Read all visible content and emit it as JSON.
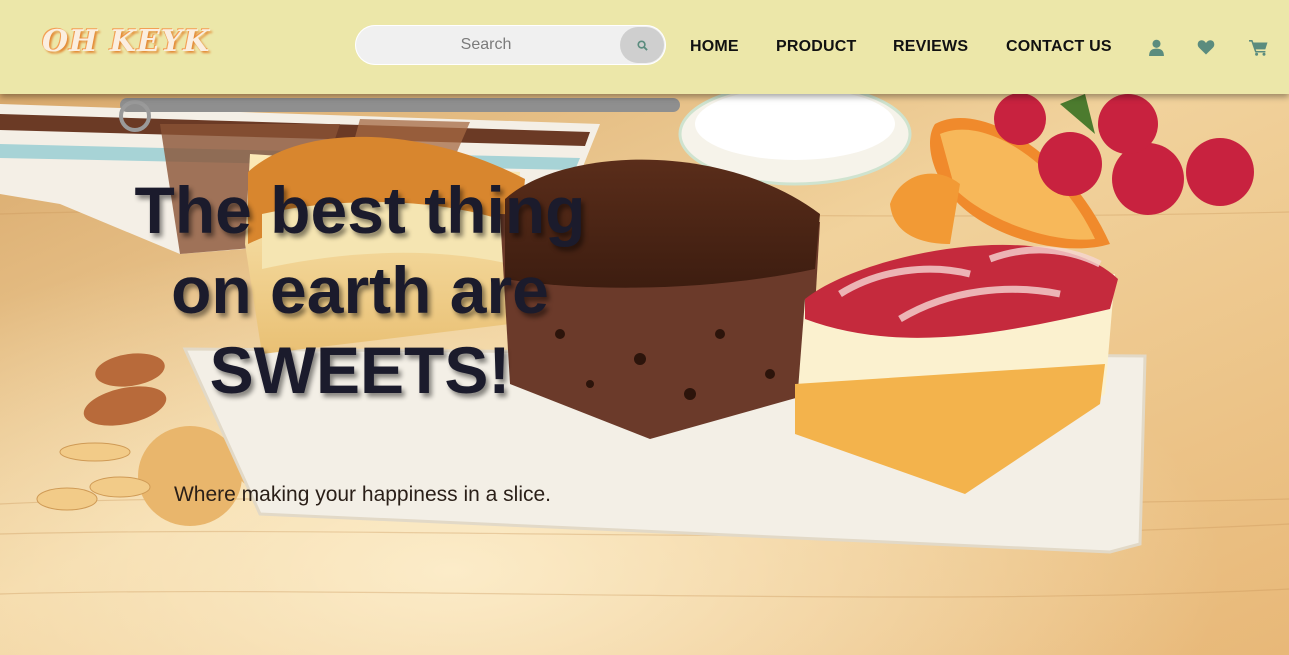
{
  "header": {
    "logo": "OH KEYK",
    "search": {
      "placeholder": "Search",
      "value": "",
      "button_icon": "search-icon"
    },
    "nav": [
      {
        "label": "HOME"
      },
      {
        "label": "PRODUCT"
      },
      {
        "label": "REVIEWS"
      },
      {
        "label": "CONTACT US"
      }
    ],
    "icons": [
      "user-icon",
      "heart-icon",
      "cart-icon"
    ],
    "colors": {
      "header_bg": "#ece7a9",
      "icon": "#5b8c7e",
      "logo": "#f3a055"
    }
  },
  "hero": {
    "headline": "The best thing on earth are SWEETS!",
    "tagline": "Where making your happiness in a slice."
  }
}
